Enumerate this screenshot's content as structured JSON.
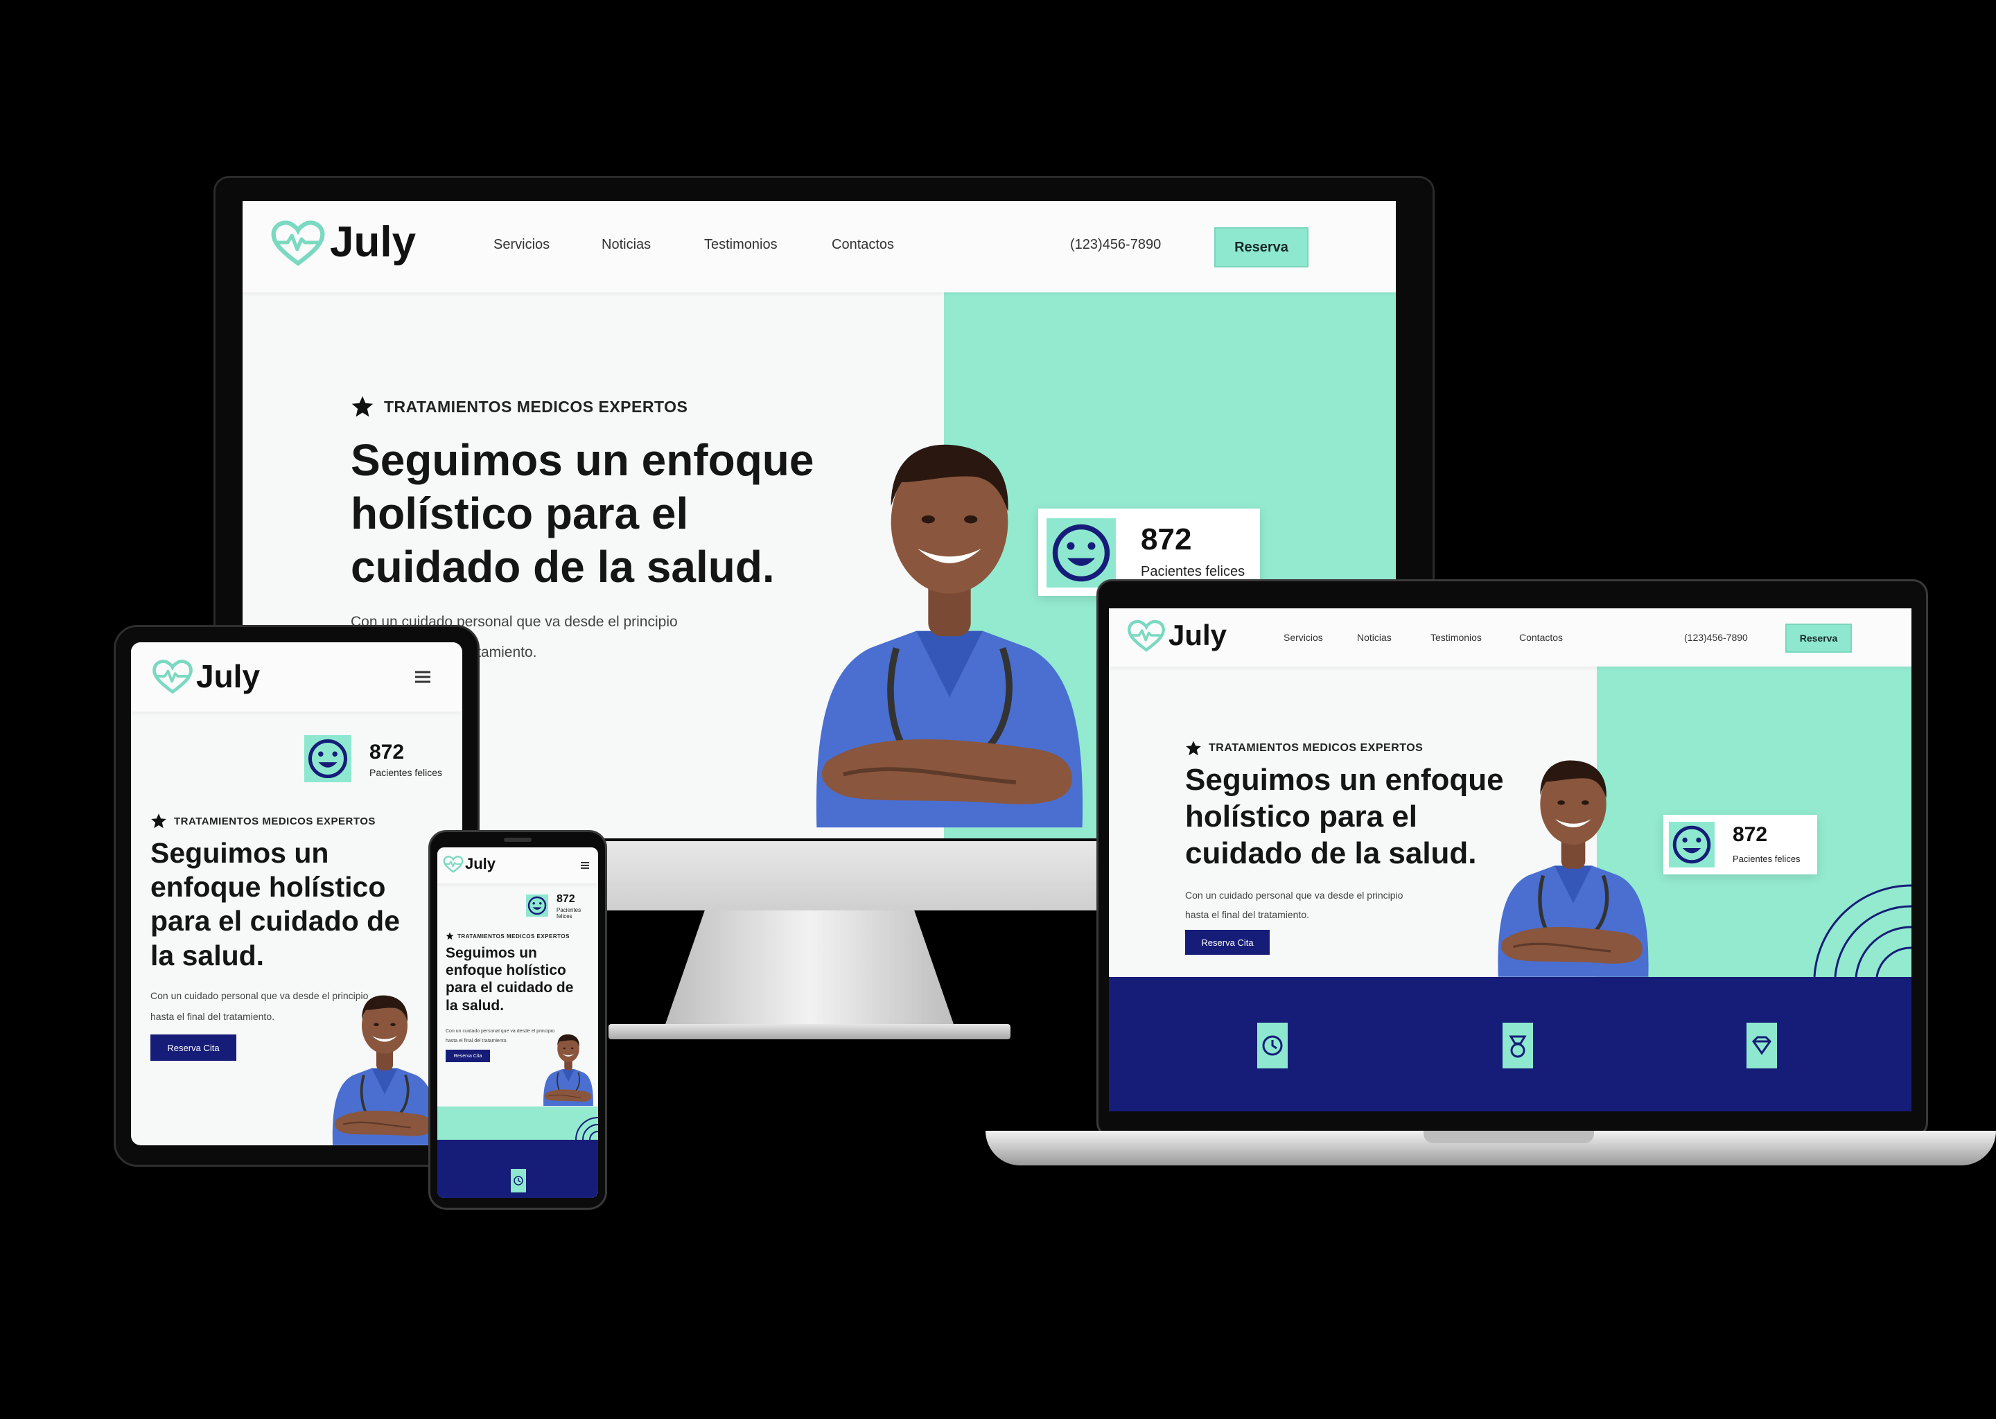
{
  "brand": {
    "name": "July"
  },
  "nav": {
    "items": [
      "Servicios",
      "Noticias",
      "Testimonios",
      "Contactos"
    ],
    "phone": "(123)456-7890",
    "cta": "Reserva"
  },
  "hero": {
    "eyebrow": "TRATAMIENTOS MEDICOS EXPERTOS",
    "title": "Seguimos un enfoque holístico para el cuidado de la salud.",
    "text_line1": "Con un cuidado personal que va desde el principio",
    "text_line2": "hasta el final del tratamiento.",
    "button": "Reserva Cita"
  },
  "stat": {
    "number": "872",
    "label": "Pacientes felices"
  },
  "colors": {
    "mint": "#93eacf",
    "navy": "#161d78",
    "scrub": "#4a6fd1"
  },
  "icons": [
    "heart-pulse-icon",
    "hamburger-menu-icon",
    "smile-icon",
    "star-icon",
    "clock-icon",
    "medal-icon",
    "diamond-icon"
  ]
}
